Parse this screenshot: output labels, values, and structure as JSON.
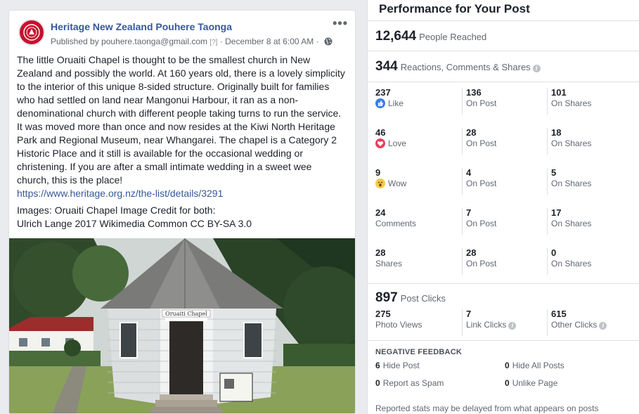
{
  "post": {
    "page_name": "Heritage New Zealand Pouhere Taonga",
    "published_by_prefix": "Published by",
    "publisher_email": "pouhere.taonga@gmail.com",
    "publisher_marker": "[?]",
    "date": "· December 8 at 6:00 AM ·",
    "more_label": "•••",
    "body": "The little Oruaiti Chapel is thought to be the smallest church in New Zealand and possibly the world. At 160 years old, there is a lovely simplicity to the interior of this unique 8-sided structure. Originally built for families who had settled on land near Mangonui Harbour, it ran as a non-denominational church with different people taking turns to run the service. It was moved more than once and now resides at the Kiwi North Heritage Park and Regional Museum, near Whangarei. The chapel is a Category 2 Historic Place and it still is available for the occasional wedding or christening. If you are after a small intimate wedding in a sweet wee church, this is the place!",
    "link": "https://www.heritage.org.nz/the-list/details/3291",
    "images_line1": "Images: Oruaiti Chapel Image Credit for both:",
    "images_line2": "Ulrich Lange 2017 Wikimedia Common CC BY-SA 3.0",
    "sign_text": "Oruaiti Chapel"
  },
  "insights": {
    "title": "Performance for Your Post",
    "reached": {
      "value": "12,644",
      "label": "People Reached"
    },
    "engagement": {
      "value": "344",
      "label": "Reactions, Comments & Shares"
    },
    "rows": [
      {
        "total": "237",
        "label": "Like",
        "icon": "like-icon",
        "on_post": "136",
        "on_post_label": "On Post",
        "on_shares": "101",
        "on_shares_label": "On Shares"
      },
      {
        "total": "46",
        "label": "Love",
        "icon": "love-icon",
        "on_post": "28",
        "on_post_label": "On Post",
        "on_shares": "18",
        "on_shares_label": "On Shares"
      },
      {
        "total": "9",
        "label": "Wow",
        "icon": "wow-icon",
        "on_post": "4",
        "on_post_label": "On Post",
        "on_shares": "5",
        "on_shares_label": "On Shares"
      },
      {
        "total": "24",
        "label": "Comments",
        "on_post": "7",
        "on_post_label": "On Post",
        "on_shares": "17",
        "on_shares_label": "On Shares"
      },
      {
        "total": "28",
        "label": "Shares",
        "on_post": "28",
        "on_post_label": "On Post",
        "on_shares": "0",
        "on_shares_label": "On Shares"
      }
    ],
    "post_clicks": {
      "value": "897",
      "label": "Post Clicks"
    },
    "clicks": [
      {
        "value": "275",
        "label": "Photo Views"
      },
      {
        "value": "7",
        "label": "Link Clicks"
      },
      {
        "value": "615",
        "label": "Other Clicks"
      }
    ],
    "negative_feedback_title": "NEGATIVE FEEDBACK",
    "negative": [
      {
        "value": "6",
        "label": "Hide Post"
      },
      {
        "value": "0",
        "label": "Hide All Posts"
      },
      {
        "value": "0",
        "label": "Report as Spam"
      },
      {
        "value": "0",
        "label": "Unlike Page"
      }
    ],
    "note": "Reported stats may be delayed from what appears on posts"
  },
  "colors": {
    "link": "#365899",
    "like": "#3b7ce6",
    "love": "#e8405d",
    "wow": "#f7c84b"
  }
}
